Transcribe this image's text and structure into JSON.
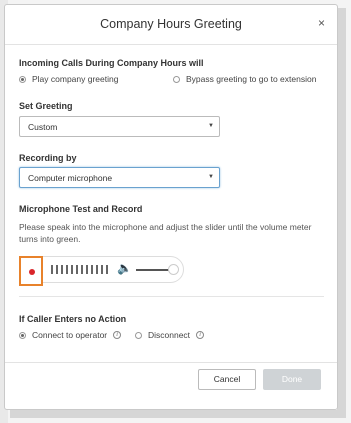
{
  "dialog": {
    "title": "Company Hours Greeting",
    "close_glyph": "×"
  },
  "incoming": {
    "label": "Incoming Calls During Company Hours will",
    "options": [
      {
        "label": "Play company greeting",
        "selected": true
      },
      {
        "label": "Bypass greeting to go to extension",
        "selected": false
      }
    ]
  },
  "set_greeting": {
    "label": "Set Greeting",
    "value": "Custom"
  },
  "recording_by": {
    "label": "Recording by",
    "value": "Computer microphone"
  },
  "mic_test": {
    "label": "Microphone Test and Record",
    "description": "Please speak into the microphone and adjust the slider until the volume meter turns into green.",
    "volume_level": 0.9,
    "record_color": "#d9252a",
    "highlight_color": "#e8822b"
  },
  "no_action": {
    "label": "If Caller Enters no Action",
    "options": [
      {
        "label": "Connect to operator",
        "selected": true,
        "info_icon": "info-icon"
      },
      {
        "label": "Disconnect",
        "selected": false,
        "info_icon": "info-icon"
      }
    ]
  },
  "footer": {
    "cancel_label": "Cancel",
    "done_label": "Done",
    "done_enabled": false
  }
}
